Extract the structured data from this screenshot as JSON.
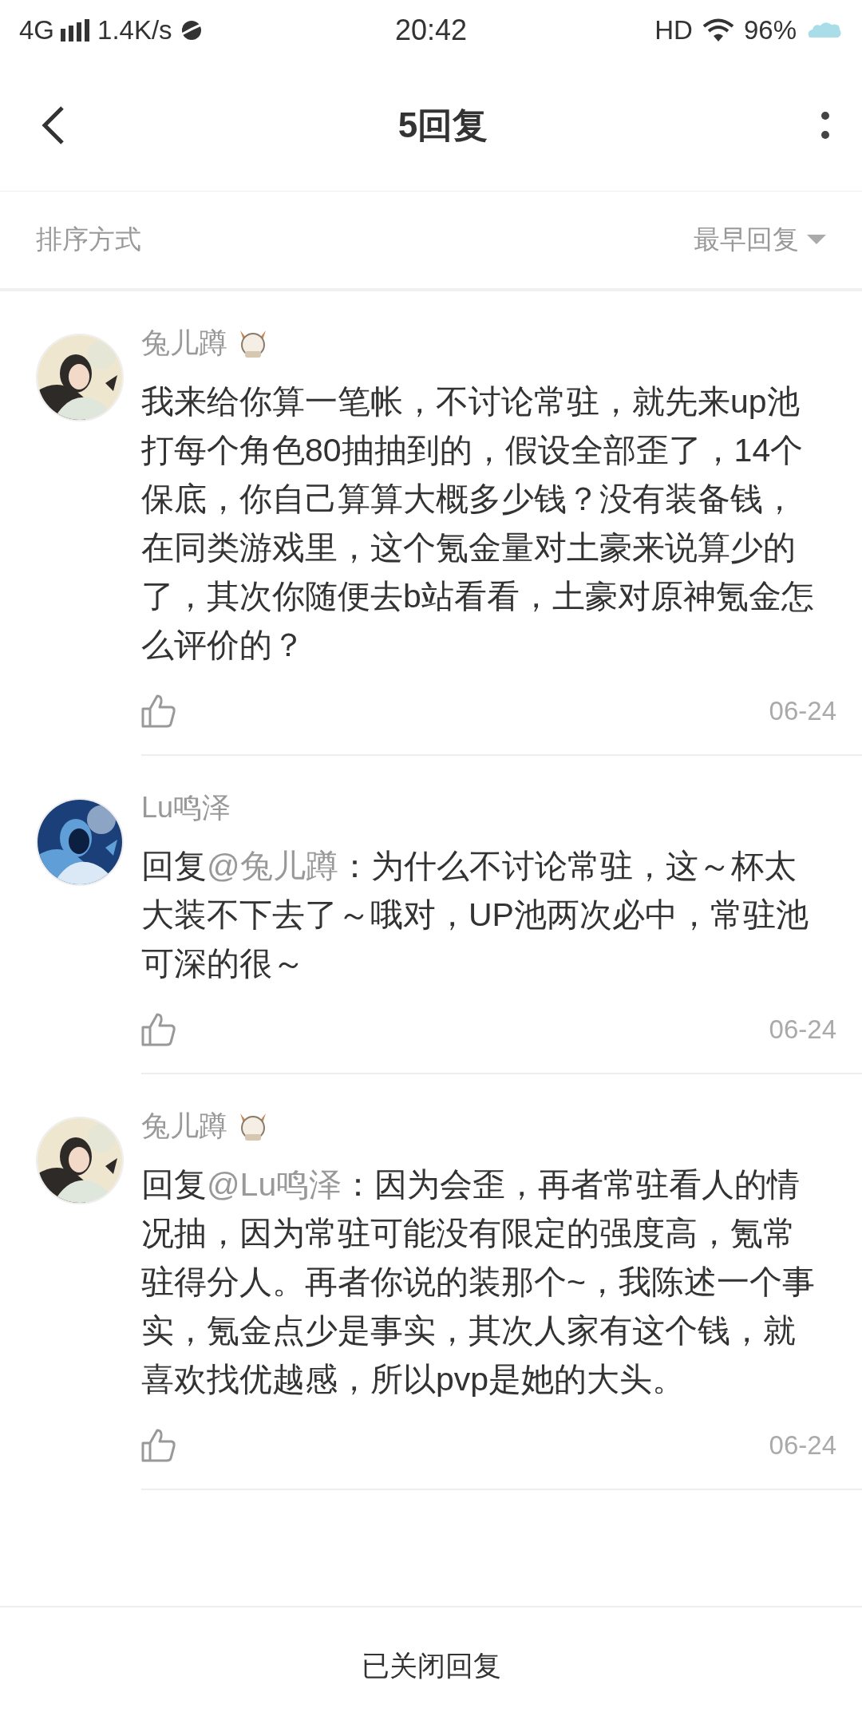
{
  "status_bar": {
    "network": "4G",
    "speed": "1.4K/s",
    "time": "20:42",
    "hd": "HD",
    "battery": "96%"
  },
  "header": {
    "title": "5回复"
  },
  "sort": {
    "label": "排序方式",
    "value": "最早回复"
  },
  "replies": [
    {
      "user": "兔儿蹲",
      "badge": true,
      "text": "我来给你算一笔帐，不讨论常驻，就先来up池打每个角色80抽抽到的，假设全部歪了，14个保底，你自己算算大概多少钱？没有装备钱，在同类游戏里，这个氪金量对土豪来说算少的了，其次你随便去b站看看，土豪对原神氪金怎么评价的？",
      "date": "06-24"
    },
    {
      "user": "Lu鸣泽",
      "badge": false,
      "prefix": "回复",
      "mention": "@兔儿蹲",
      "text": "：为什么不讨论常驻，这～杯太大装不下去了～哦对，UP池两次必中，常驻池可深的很～",
      "date": "06-24"
    },
    {
      "user": "兔儿蹲",
      "badge": true,
      "prefix": "回复",
      "mention": "@Lu鸣泽",
      "text": "：因为会歪，再者常驻看人的情况抽，因为常驻可能没有限定的强度高，氪常驻得分人。再者你说的装那个~，我陈述一个事实，氪金点少是事实，其次人家有这个钱，就喜欢找优越感，所以pvp是她的大头。",
      "date": "06-24"
    }
  ],
  "footer": {
    "label": "已关闭回复"
  }
}
